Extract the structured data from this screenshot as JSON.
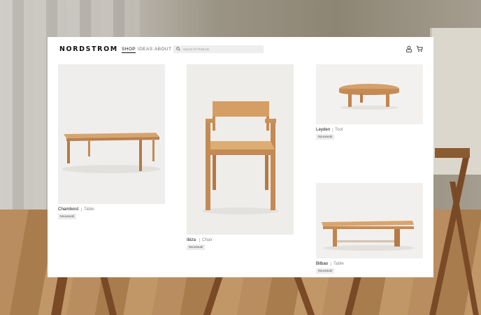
{
  "brand": "NORDSTROM",
  "nav": {
    "shop": "SHOP",
    "ideas": "IDEAS",
    "about": "ABOUT"
  },
  "search": {
    "placeholder": "Search for Products"
  },
  "products": [
    {
      "name": "Chambord",
      "type": "Table",
      "badge": "Nouveauté"
    },
    {
      "name": "Ibiza",
      "type": "Chair",
      "badge": "Nouveauté"
    },
    {
      "name": "Leyden",
      "type": "Tool",
      "badge": "Nouveauté"
    },
    {
      "name": "Bilbao",
      "type": "Table",
      "badge": "Nouveauté"
    }
  ],
  "colors": {
    "wood": "#c98b55",
    "wood_dark": "#a96a3a",
    "image_bg": "#f2f1ef"
  }
}
